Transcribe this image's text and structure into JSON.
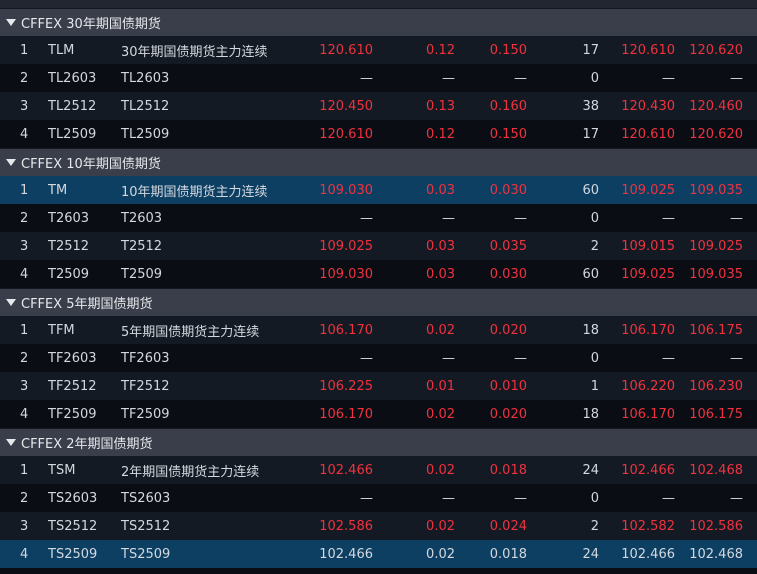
{
  "colors": {
    "up": "#f0323e",
    "neutral": "#d4d8de",
    "selected_row": "#0d3f63",
    "group_header": "#3a3e4a"
  },
  "groups": [
    {
      "title": "CFFEX 30年期国债期货",
      "rows": [
        {
          "idx": "1",
          "code": "TLM",
          "name": "30年期国债期货主力连续",
          "last": "120.610",
          "chg": "0.12",
          "pct": "0.150",
          "vol": "17",
          "bid": "120.610",
          "ask": "120.620",
          "trend": "up"
        },
        {
          "idx": "2",
          "code": "TL2603",
          "name": "TL2603",
          "last": "—",
          "chg": "—",
          "pct": "—",
          "vol": "0",
          "bid": "—",
          "ask": "—",
          "trend": "neutral"
        },
        {
          "idx": "3",
          "code": "TL2512",
          "name": "TL2512",
          "last": "120.450",
          "chg": "0.13",
          "pct": "0.160",
          "vol": "38",
          "bid": "120.430",
          "ask": "120.460",
          "trend": "up"
        },
        {
          "idx": "4",
          "code": "TL2509",
          "name": "TL2509",
          "last": "120.610",
          "chg": "0.12",
          "pct": "0.150",
          "vol": "17",
          "bid": "120.610",
          "ask": "120.620",
          "trend": "up"
        }
      ]
    },
    {
      "title": "CFFEX 10年期国债期货",
      "rows": [
        {
          "idx": "1",
          "code": "TM",
          "name": "10年期国债期货主力连续",
          "last": "109.030",
          "chg": "0.03",
          "pct": "0.030",
          "vol": "60",
          "bid": "109.025",
          "ask": "109.035",
          "trend": "up",
          "selected": true
        },
        {
          "idx": "2",
          "code": "T2603",
          "name": "T2603",
          "last": "—",
          "chg": "—",
          "pct": "—",
          "vol": "0",
          "bid": "—",
          "ask": "—",
          "trend": "neutral"
        },
        {
          "idx": "3",
          "code": "T2512",
          "name": "T2512",
          "last": "109.025",
          "chg": "0.03",
          "pct": "0.035",
          "vol": "2",
          "bid": "109.015",
          "ask": "109.025",
          "trend": "up"
        },
        {
          "idx": "4",
          "code": "T2509",
          "name": "T2509",
          "last": "109.030",
          "chg": "0.03",
          "pct": "0.030",
          "vol": "60",
          "bid": "109.025",
          "ask": "109.035",
          "trend": "up"
        }
      ]
    },
    {
      "title": "CFFEX 5年期国债期货",
      "rows": [
        {
          "idx": "1",
          "code": "TFM",
          "name": "5年期国债期货主力连续",
          "last": "106.170",
          "chg": "0.02",
          "pct": "0.020",
          "vol": "18",
          "bid": "106.170",
          "ask": "106.175",
          "trend": "up"
        },
        {
          "idx": "2",
          "code": "TF2603",
          "name": "TF2603",
          "last": "—",
          "chg": "—",
          "pct": "—",
          "vol": "0",
          "bid": "—",
          "ask": "—",
          "trend": "neutral"
        },
        {
          "idx": "3",
          "code": "TF2512",
          "name": "TF2512",
          "last": "106.225",
          "chg": "0.01",
          "pct": "0.010",
          "vol": "1",
          "bid": "106.220",
          "ask": "106.230",
          "trend": "up"
        },
        {
          "idx": "4",
          "code": "TF2509",
          "name": "TF2509",
          "last": "106.170",
          "chg": "0.02",
          "pct": "0.020",
          "vol": "18",
          "bid": "106.170",
          "ask": "106.175",
          "trend": "up"
        }
      ]
    },
    {
      "title": "CFFEX 2年期国债期货",
      "rows": [
        {
          "idx": "1",
          "code": "TSM",
          "name": "2年期国债期货主力连续",
          "last": "102.466",
          "chg": "0.02",
          "pct": "0.018",
          "vol": "24",
          "bid": "102.466",
          "ask": "102.468",
          "trend": "up"
        },
        {
          "idx": "2",
          "code": "TS2603",
          "name": "TS2603",
          "last": "—",
          "chg": "—",
          "pct": "—",
          "vol": "0",
          "bid": "—",
          "ask": "—",
          "trend": "neutral"
        },
        {
          "idx": "3",
          "code": "TS2512",
          "name": "TS2512",
          "last": "102.586",
          "chg": "0.02",
          "pct": "0.024",
          "vol": "2",
          "bid": "102.582",
          "ask": "102.586",
          "trend": "up"
        },
        {
          "idx": "4",
          "code": "TS2509",
          "name": "TS2509",
          "last": "102.466",
          "chg": "0.02",
          "pct": "0.018",
          "vol": "24",
          "bid": "102.466",
          "ask": "102.468",
          "trend": "neutral",
          "selected": true
        }
      ]
    }
  ]
}
